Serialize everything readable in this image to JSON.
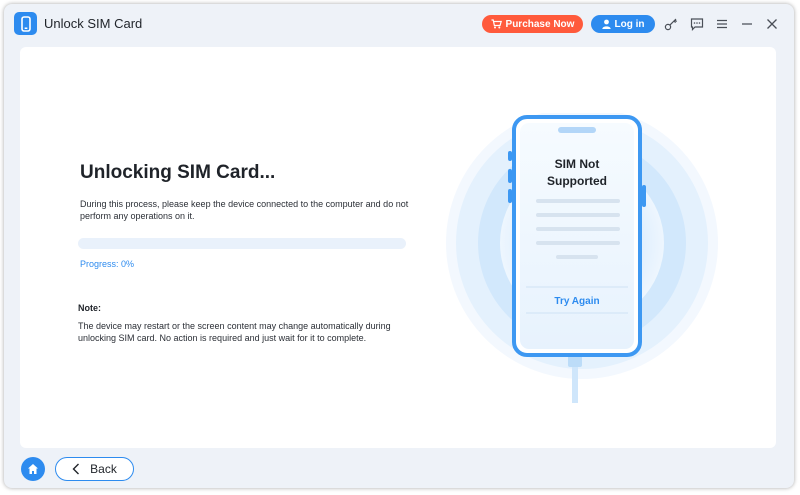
{
  "app": {
    "title": "Unlock SIM Card",
    "icon": "phone-app-icon"
  },
  "header": {
    "purchase_label": "Purchase Now",
    "login_label": "Log in",
    "icons": [
      "cart-icon",
      "user-icon",
      "key-icon",
      "feedback-icon",
      "menu-icon",
      "minimize-icon",
      "close-icon"
    ]
  },
  "main": {
    "heading": "Unlocking SIM Card...",
    "description": "During this process, please keep the device connected to the computer and do not perform any operations on it.",
    "progress_value": 0,
    "progress_label": "Progress: 0%",
    "note_title": "Note:",
    "note_text": "The device may restart or the screen content may change automatically during unlocking SIM card. No action is required and just wait for it to complete."
  },
  "phone": {
    "line1": "SIM Not",
    "line2": "Supported",
    "try_again_label": "Try Again"
  },
  "footer": {
    "back_label": "Back",
    "icons": [
      "home-icon",
      "back-arrow-icon"
    ]
  },
  "colors": {
    "accent": "#2d8bef",
    "purchase": "#ff5a3c",
    "window_bg": "#eef2f8",
    "card_bg": "#ffffff"
  }
}
